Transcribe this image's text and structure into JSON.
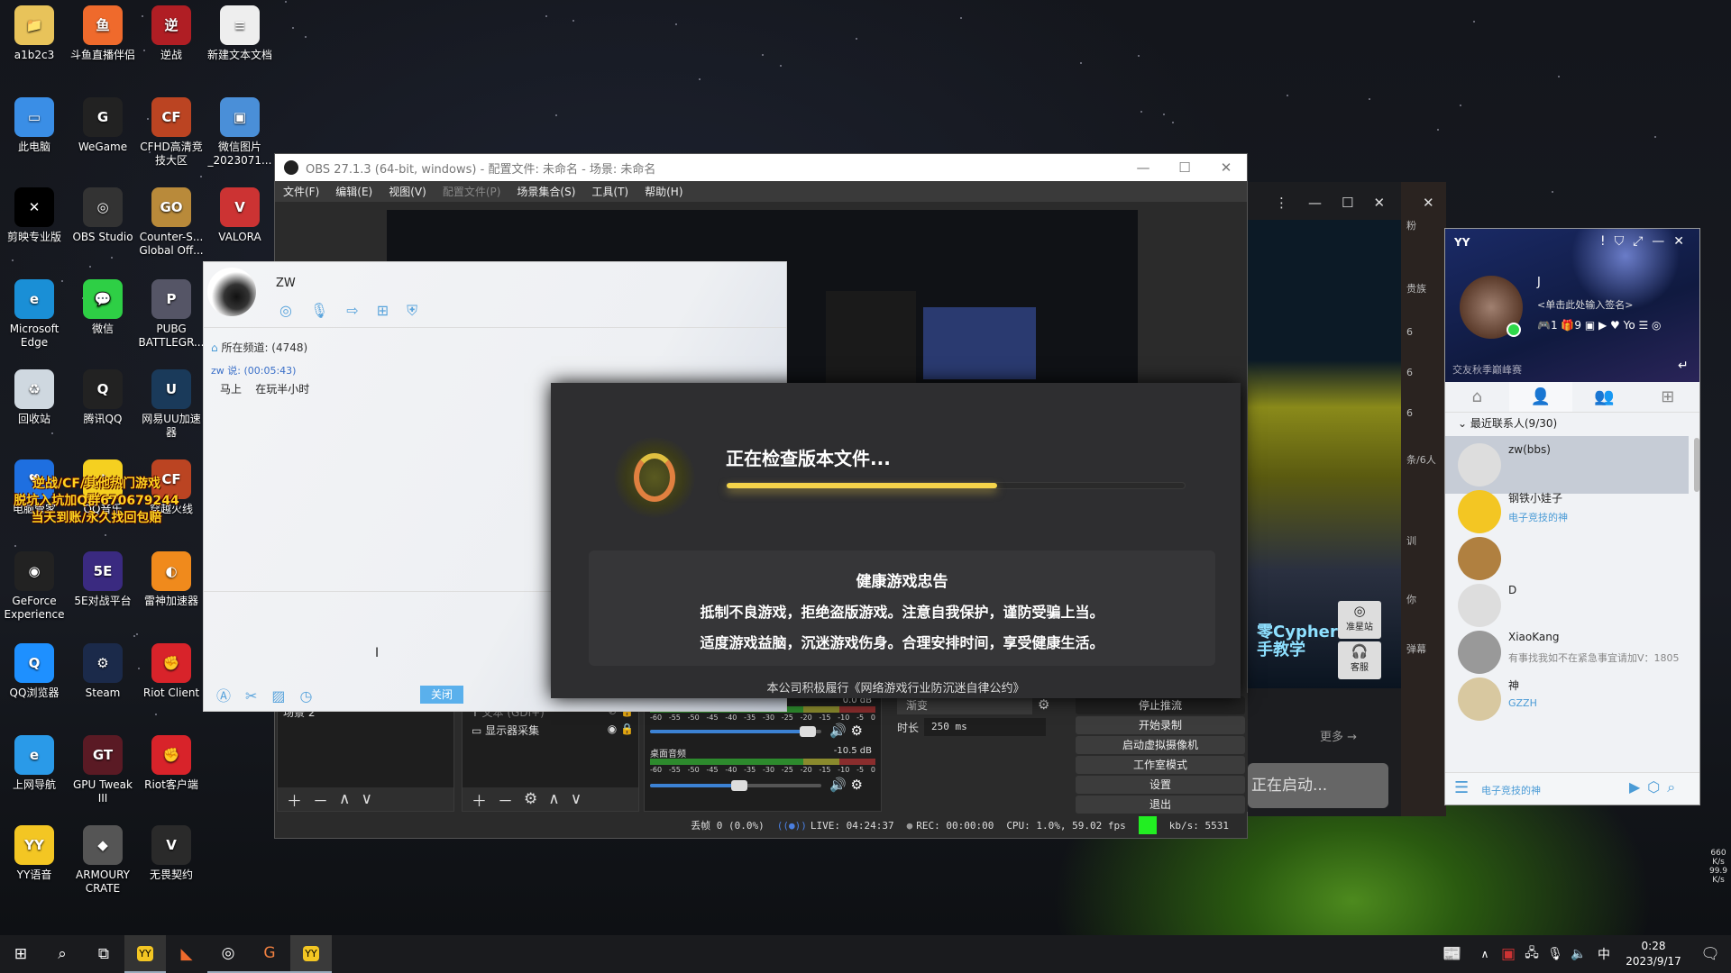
{
  "desktop": {
    "icons": [
      {
        "label": "a1b2c3",
        "color": "#e8c35a",
        "glyph": "📁",
        "col": 0,
        "row": 0
      },
      {
        "label": "斗鱼直播伴侣",
        "color": "#ef6a2c",
        "glyph": "鱼",
        "col": 1,
        "row": 0
      },
      {
        "label": "逆战",
        "color": "#b01e24",
        "glyph": "逆",
        "col": 2,
        "row": 0
      },
      {
        "label": "新建文本文档",
        "color": "#eeeeee",
        "glyph": "≡",
        "col": 3,
        "row": 0
      },
      {
        "label": "此电脑",
        "color": "#3a8ee6",
        "glyph": "▭",
        "col": 0,
        "row": 1
      },
      {
        "label": "WeGame",
        "color": "#222",
        "glyph": "G",
        "col": 1,
        "row": 1
      },
      {
        "label": "CFHD高清竞技大区",
        "color": "#b42",
        "glyph": "CF",
        "col": 2,
        "row": 1
      },
      {
        "label": "微信图片_2023071...",
        "color": "#4a8fd8",
        "glyph": "▣",
        "col": 3,
        "row": 1
      },
      {
        "label": "剪映专业版",
        "color": "#000",
        "glyph": "✕",
        "col": 0,
        "row": 2
      },
      {
        "label": "OBS Studio",
        "color": "#333",
        "glyph": "◎",
        "col": 1,
        "row": 2
      },
      {
        "label": "Counter-S... Global Off...",
        "color": "#b98a3a",
        "glyph": "GO",
        "col": 2,
        "row": 2
      },
      {
        "label": "VALORA",
        "color": "#c33",
        "glyph": "V",
        "col": 3,
        "row": 2
      },
      {
        "label": "Microsoft Edge",
        "color": "#1a8fd6",
        "glyph": "e",
        "col": 0,
        "row": 3
      },
      {
        "label": "微信",
        "color": "#2ecf45",
        "glyph": "💬",
        "col": 1,
        "row": 3
      },
      {
        "label": "PUBG BATTLEGR...",
        "color": "#556",
        "glyph": "P",
        "col": 2,
        "row": 3
      },
      {
        "label": "回收站",
        "color": "#cfd8e0",
        "glyph": "♻",
        "col": 0,
        "row": 4
      },
      {
        "label": "腾讯QQ",
        "color": "#222",
        "glyph": "Q",
        "col": 1,
        "row": 4
      },
      {
        "label": "网易UU加速器",
        "color": "#1a3a5a",
        "glyph": "U",
        "col": 2,
        "row": 4
      },
      {
        "label": "电脑管家",
        "color": "#1e6fe0",
        "glyph": "♥",
        "col": 0,
        "row": 5
      },
      {
        "label": "QQ音乐",
        "color": "#f5d020",
        "glyph": "♪",
        "col": 1,
        "row": 5
      },
      {
        "label": "穿越火线",
        "color": "#b42",
        "glyph": "CF",
        "col": 2,
        "row": 5
      },
      {
        "label": "GeForce Experience",
        "color": "#222",
        "glyph": "◉",
        "col": 0,
        "row": 6
      },
      {
        "label": "5E对战平台",
        "color": "#3a2a80",
        "glyph": "5E",
        "col": 1,
        "row": 6
      },
      {
        "label": "雷神加速器",
        "color": "#f08a1c",
        "glyph": "◐",
        "col": 2,
        "row": 6
      },
      {
        "label": "QQ浏览器",
        "color": "#1e90ff",
        "glyph": "Q",
        "col": 0,
        "row": 7
      },
      {
        "label": "Steam",
        "color": "#1b2a4a",
        "glyph": "⚙",
        "col": 1,
        "row": 7
      },
      {
        "label": "Riot Client",
        "color": "#d8232a",
        "glyph": "✊",
        "col": 2,
        "row": 7
      },
      {
        "label": "上网导航",
        "color": "#2a9ae8",
        "glyph": "e",
        "col": 0,
        "row": 8
      },
      {
        "label": "GPU Tweak III",
        "color": "#5a1a24",
        "glyph": "GT",
        "col": 1,
        "row": 8
      },
      {
        "label": "Riot客户端",
        "color": "#d8232a",
        "glyph": "✊",
        "col": 2,
        "row": 8
      },
      {
        "label": "YY语音",
        "color": "#f3c623",
        "glyph": "YY",
        "col": 0,
        "row": 9
      },
      {
        "label": "ARMOURY CRATE",
        "color": "#555",
        "glyph": "◆",
        "col": 1,
        "row": 9
      },
      {
        "label": "无畏契约",
        "color": "#2a2a2a",
        "glyph": "V",
        "col": 2,
        "row": 9
      }
    ],
    "ad_lines": [
      "逆战/CF/其他热门游戏",
      "脱坑入坑加Q群670679244",
      "当天到账/永久找回包赔"
    ]
  },
  "obs": {
    "title": "OBS 27.1.3 (64-bit, windows) - 配置文件: 未命名 - 场景: 未命名",
    "menu": [
      {
        "label": "文件(F)"
      },
      {
        "label": "编辑(E)"
      },
      {
        "label": "视图(V)"
      },
      {
        "label": "配置文件(P)",
        "disabled": true
      },
      {
        "label": "场景集合(S)"
      },
      {
        "label": "工具(T)"
      },
      {
        "label": "帮助(H)"
      }
    ],
    "scenes": [
      "场景 2"
    ],
    "sources": [
      {
        "label": "文本 (GDI+)",
        "visible": false
      },
      {
        "label": "显示器采集",
        "visible": true
      }
    ],
    "mixer": {
      "tracks": [
        {
          "name": "",
          "db": "0.0 dB",
          "volume": 0.97
        },
        {
          "name": "桌面音频",
          "db": "-10.5 dB",
          "volume": 0.57
        }
      ],
      "ticks": [
        "-60",
        "-55",
        "-50",
        "-45",
        "-40",
        "-35",
        "-30",
        "-25",
        "-20",
        "-15",
        "-10",
        "-5",
        "0"
      ]
    },
    "transition": {
      "type": "渐变",
      "duration_label": "时长",
      "duration": "250 ms"
    },
    "controls": [
      "停止推流",
      "开始录制",
      "启动虚拟摄像机",
      "工作室模式",
      "设置",
      "退出"
    ],
    "status": {
      "dropped": "丢帧 0 (0.0%)",
      "live": "LIVE: 04:24:37",
      "rec": "REC: 00:00:00",
      "cpu": "CPU: 1.0%, 59.02 fps",
      "kbps": "kb/s: 5531",
      "health_color": "#22ee22"
    }
  },
  "chat": {
    "name": "ZW",
    "channel": "所在频道: (4748)",
    "sender": "zw 说: (00:05:43)",
    "message": "马上    在玩半小时",
    "close_label": "关闭"
  },
  "wegame": {
    "status": "正在检查版本文件...",
    "progress": 0.59,
    "accent": "#f5d44a",
    "notice_title": "健康游戏忠告",
    "notice_lines": [
      "抵制不良游戏，拒绝盗版游戏。注意自我保护，谨防受骗上当。",
      "适度游戏益脑，沉迷游戏伤身。合理安排时间，享受健康生活。"
    ],
    "footer": "本公司积极履行《网络游戏行业防沉迷自律公约》"
  },
  "dark_window": {
    "banner": "零Cypher 新手教学",
    "more": "更多 →",
    "launching": "正在启动...",
    "side_buttons": [
      "准星站",
      "客服"
    ],
    "side_texts": [
      "粉",
      "贵族",
      "6",
      "6",
      "6",
      "条/6人",
      "训",
      "你",
      "弹幕"
    ]
  },
  "yy": {
    "app": "YY",
    "user": "J",
    "signature": "<单击此处输入签名>",
    "badges": [
      "1",
      "9"
    ],
    "banner": "交友秋季巅峰赛",
    "section": "最近联系人(9/30)",
    "contacts": [
      {
        "name": "zw(bbs)",
        "sub": ""
      },
      {
        "name": "钢铁小娃子",
        "sub": "电子竞技的神"
      },
      {
        "name": "",
        "sub": ""
      },
      {
        "name": "D",
        "sub": ""
      },
      {
        "name": "XiaoKang",
        "sub": "有事找我如不在紧急事宜请加V：1805"
      },
      {
        "name": "神",
        "sub": "GZZH"
      }
    ],
    "footer": "电子竞技的神"
  },
  "netspeed": {
    "up": "660 K/s",
    "down": "99.9 K/s"
  },
  "taskbar": {
    "time": "0:28",
    "date": "2023/9/17",
    "ime": "中"
  }
}
